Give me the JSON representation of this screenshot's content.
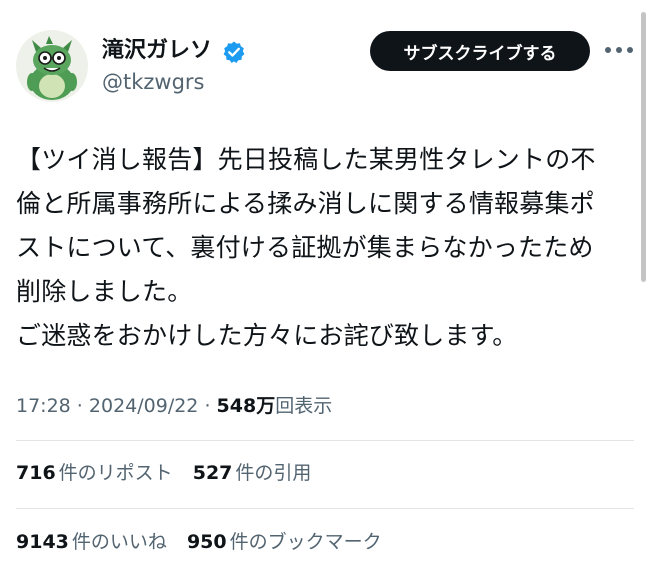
{
  "profile": {
    "display_name": "滝沢ガレソ",
    "handle": "@tkzwgrs",
    "avatar_icon": "dragon-avatar-icon",
    "verified_icon": "verified-badge-icon",
    "verified_color": "#1d9bf0"
  },
  "actions": {
    "subscribe_label": "サブスクライブする",
    "more_icon": "more-options-icon"
  },
  "tweet": {
    "lines": [
      "【ツイ消し報告】先日投稿した某男性タレントの不",
      "倫と所属事務所による揉み消しに関する情報募集ポ",
      "ストについて、裏付ける証拠が集まらなかったため",
      "削除しました。",
      "ご迷惑をおかけした方々にお詫び致します。"
    ]
  },
  "meta": {
    "time": "17:28",
    "separator1": " · ",
    "date": "2024/09/22",
    "separator2": " · ",
    "views_count": "548万",
    "views_label": "回表示"
  },
  "stats": {
    "reposts": {
      "count": "716",
      "label": "件のリポスト"
    },
    "quotes": {
      "count": "527",
      "label": "件の引用"
    },
    "likes": {
      "count": "9143",
      "label": "件のいいね"
    },
    "bookmarks": {
      "count": "950",
      "label": "件のブックマーク"
    }
  },
  "colors": {
    "text": "#0f1419",
    "secondary_text": "#536471",
    "button_bg": "#0f1419",
    "divider": "#e2e6e9"
  }
}
